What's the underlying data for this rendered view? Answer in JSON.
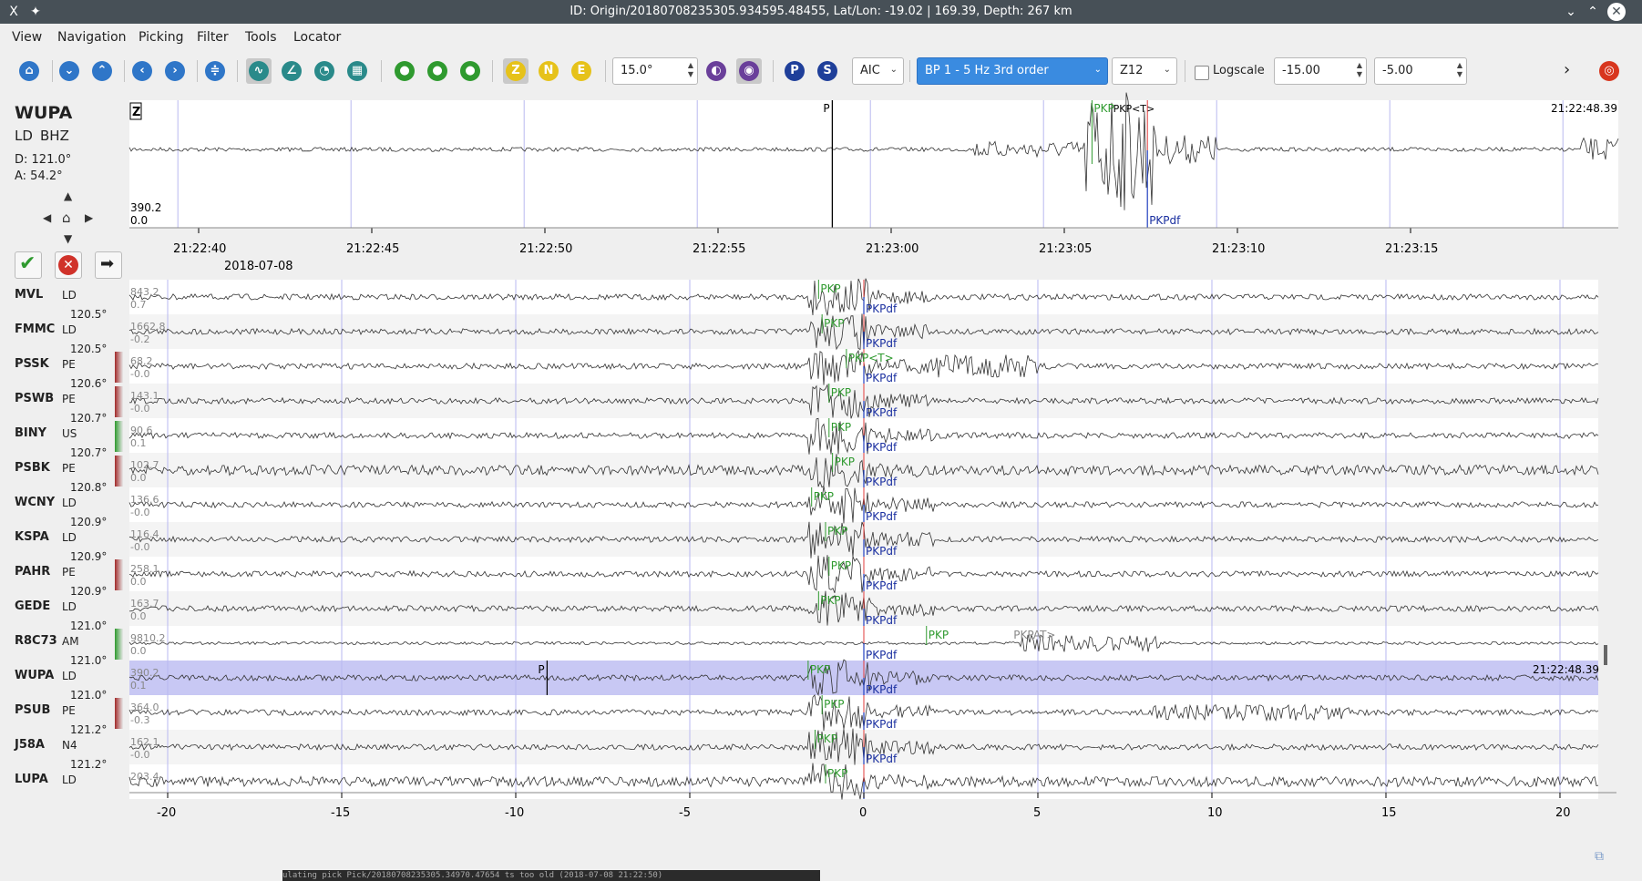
{
  "window": {
    "title": "ID: Origin/20180708235305.934595.48455, Lat/Lon: -19.02 | 169.39, Depth: 267 km",
    "app_icon": "x-icon",
    "pin_icon": "pin-icon",
    "controls": [
      "chevron-down-icon",
      "chevron-up-icon",
      "close-icon"
    ]
  },
  "menu": [
    "View",
    "Navigation",
    "Picking",
    "Filter",
    "Tools",
    "Locator"
  ],
  "toolbar": {
    "component_buttons": [
      "Z",
      "N",
      "E"
    ],
    "phase_buttons": [
      "P",
      "S"
    ],
    "distance_value": "15.0°",
    "picker_method": "AIC",
    "filter_value": "BP 1 - 5 Hz  3rd order",
    "rotation_value": "Z12",
    "logscale_label": "Logscale",
    "logscale_checked": false,
    "min_value": "-15.00",
    "max_value": "-5.00",
    "more_arrow": "›",
    "colors": {
      "nav_blue": "#2f76c8",
      "pick_green": "#2f9a2f",
      "comp_yellow": "#e6c21a",
      "filter_purple": "#6a3f9a",
      "phase_navy": "#1f3f9a",
      "locate_red": "#d8361e"
    }
  },
  "current_trace": {
    "station": "WUPA",
    "network": "LD",
    "channel": "BHZ",
    "distance": "D:  121.0°",
    "azimuth": "A:  54.2°",
    "component": "Z",
    "amp_max": "390.2",
    "amp_min": "0.0",
    "time_label": "21:22:48.39",
    "picks": [
      {
        "label": "P",
        "t": -9.1,
        "color": "#000000"
      },
      {
        "label": "PKP",
        "t": -1.6,
        "color": "#2f9a2f"
      },
      {
        "label": "PKP<T>",
        "t": -1.2,
        "color": "#000000"
      }
    ],
    "theoretical": {
      "label": "PKPdf",
      "t": 0.0
    },
    "axis_ticks": [
      "21:22:40",
      "21:22:45",
      "21:22:50",
      "21:22:55",
      "21:23:00",
      "21:23:05",
      "21:23:10",
      "21:23:15"
    ],
    "axis_date": "2018-07-08"
  },
  "actions": {
    "accept_icon": "check-icon",
    "reject_icon": "cancel-icon",
    "apply_icon": "arrow-right-icon"
  },
  "traces": [
    {
      "station": "MVL",
      "network": "LD",
      "distance": "120.5°",
      "amp_max": "843.2",
      "amp_min": "0.7",
      "status": "",
      "pick_t": -1.3,
      "pick_label": "PKP",
      "pick_type": "theo",
      "theo_label": "PKPdf"
    },
    {
      "station": "FMMC",
      "network": "LD",
      "distance": "120.5°",
      "amp_max": "1662.8",
      "amp_min": "-0.2",
      "status": "",
      "pick_t": -1.2,
      "pick_label": "PKP",
      "pick_type": "theo",
      "theo_label": "PKPdf"
    },
    {
      "station": "PSSK",
      "network": "PE",
      "distance": "120.6°",
      "amp_max": "68.2",
      "amp_min": "-0.0",
      "status": "#a12a2a",
      "pick_t": -0.5,
      "pick_label": "PKP<T>",
      "pick_type": "theo",
      "theo_label": "PKPdf"
    },
    {
      "station": "PSWB",
      "network": "PE",
      "distance": "120.7°",
      "amp_max": "143.1",
      "amp_min": "-0.0",
      "status": "#a12a2a",
      "pick_t": -1.0,
      "pick_label": "PKP",
      "pick_type": "theo",
      "theo_label": "PKPdf"
    },
    {
      "station": "BINY",
      "network": "US",
      "distance": "120.7°",
      "amp_max": "90.6",
      "amp_min": "0.1",
      "status": "#2f9a2f",
      "pick_t": -1.0,
      "pick_label": "PKP",
      "pick_type": "manual",
      "theo_label": "PKPdf"
    },
    {
      "station": "PSBK",
      "network": "PE",
      "distance": "120.8°",
      "amp_max": "102.7",
      "amp_min": "0.0",
      "status": "#a12a2a",
      "pick_t": -0.9,
      "pick_label": "PKP",
      "pick_type": "theo",
      "theo_label": "PKPdf"
    },
    {
      "station": "WCNY",
      "network": "LD",
      "distance": "120.9°",
      "amp_max": "136.6",
      "amp_min": "-0.0",
      "status": "",
      "pick_t": -1.5,
      "pick_label": "PKP",
      "pick_type": "theo",
      "theo_label": "PKPdf"
    },
    {
      "station": "KSPA",
      "network": "LD",
      "distance": "120.9°",
      "amp_max": "116.4",
      "amp_min": "-0.0",
      "status": "",
      "pick_t": -1.1,
      "pick_label": "PKP",
      "pick_type": "theo",
      "theo_label": "PKPdf"
    },
    {
      "station": "PAHR",
      "network": "PE",
      "distance": "120.9°",
      "amp_max": "258.1",
      "amp_min": "0.0",
      "status": "#a12a2a",
      "pick_t": -1.0,
      "pick_label": "PKP",
      "pick_type": "theo",
      "theo_label": "PKPdf"
    },
    {
      "station": "GEDE",
      "network": "LD",
      "distance": "121.0°",
      "amp_max": "163.7",
      "amp_min": "0.0",
      "status": "",
      "pick_t": -1.3,
      "pick_label": "PKP",
      "pick_type": "theo",
      "theo_label": "PKPdf"
    },
    {
      "station": "R8C73",
      "network": "AM",
      "distance": "121.0°",
      "amp_max": "9810.2",
      "amp_min": "0.0",
      "status": "#2f9a2f",
      "pick_t": 1.8,
      "pick_label": "PKP",
      "pick_type": "manual",
      "theo_label": "PKPdf",
      "extra_label": "PKPAT>",
      "extra_t": 4.3
    },
    {
      "station": "WUPA",
      "network": "LD",
      "distance": "121.0°",
      "amp_max": "390.2",
      "amp_min": "0.1",
      "status": "",
      "pick_t": -1.6,
      "pick_label": "PKP",
      "pick_type": "manual",
      "theo_label": "PKPdf",
      "selected": true,
      "p_label": "P",
      "p_t": -9.1,
      "time_label": "21:22:48.39"
    },
    {
      "station": "PSUB",
      "network": "PE",
      "distance": "121.2°",
      "amp_max": "364.0",
      "amp_min": "-0.3",
      "status": "#a12a2a",
      "pick_t": -1.2,
      "pick_label": "PKP",
      "pick_type": "theo",
      "theo_label": "PKPdf"
    },
    {
      "station": "J58A",
      "network": "N4",
      "distance": "121.2°",
      "amp_max": "162.1",
      "amp_min": "-0.0",
      "status": "",
      "pick_t": -1.4,
      "pick_label": "PKP",
      "pick_type": "theo",
      "theo_label": "PKPdf"
    },
    {
      "station": "LUPA",
      "network": "LD",
      "distance": "",
      "amp_max": "203.4",
      "amp_min": "",
      "status": "",
      "pick_t": -1.1,
      "pick_label": "PKP",
      "pick_type": "theo",
      "theo_label": ""
    }
  ],
  "relative_axis": {
    "ticks": [
      -20,
      -15,
      -10,
      -5,
      0,
      5,
      10,
      15,
      20
    ]
  },
  "footer": {
    "text": "ulating pick  Pick/20180708235305.34970.47654  ts too old (2018-07-08 21:22:50)"
  }
}
